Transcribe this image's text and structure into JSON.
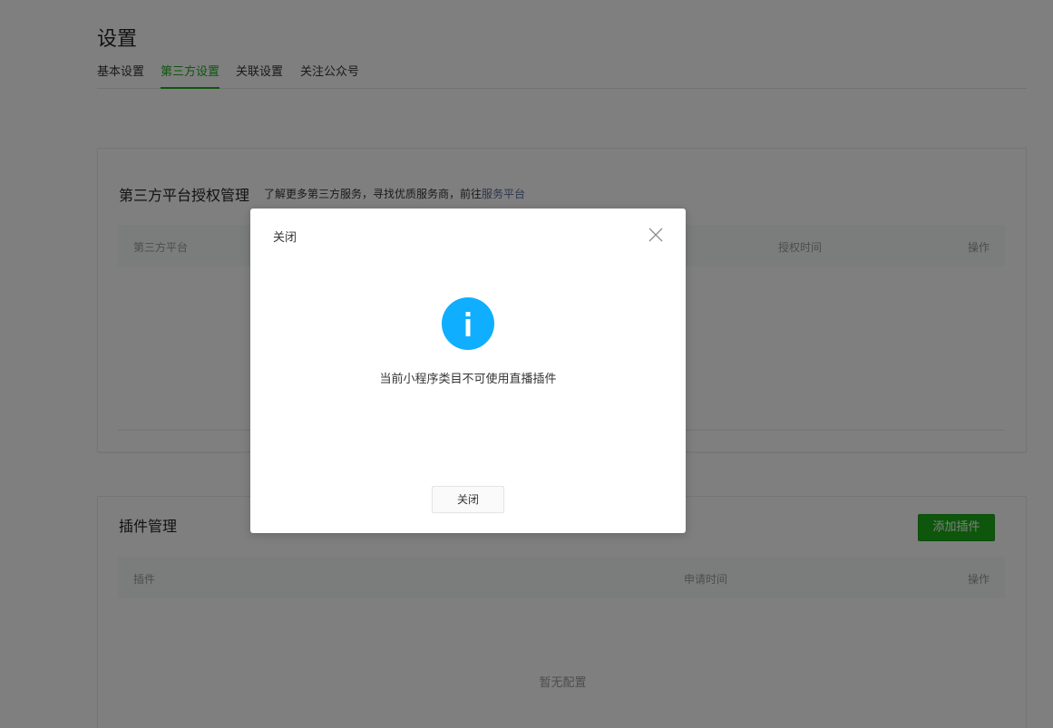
{
  "page": {
    "title": "设置"
  },
  "tabs": [
    {
      "label": "基本设置"
    },
    {
      "label": "第三方设置",
      "active": true
    },
    {
      "label": "关联设置"
    },
    {
      "label": "关注公众号"
    }
  ],
  "third_party": {
    "title": "第三方平台授权管理",
    "desc_prefix": "了解更多第三方服务，寻找优质服务商，前往",
    "desc_link": "服务平台",
    "columns": [
      "第三方平台",
      "授权时间",
      "操作"
    ]
  },
  "plugins": {
    "title": "插件管理",
    "add_button": "添加插件",
    "columns": [
      "插件",
      "申请时间",
      "操作"
    ],
    "empty_text": "暂无配置"
  },
  "dialog": {
    "title": "关闭",
    "icon": "info-icon",
    "message": "当前小程序类目不可使用直播插件",
    "button_label": "关闭"
  },
  "colors": {
    "accent": "#1aad19",
    "link": "#576b95",
    "info": "#10aeff",
    "overlay": "rgba(0,0,0,0.5)"
  }
}
